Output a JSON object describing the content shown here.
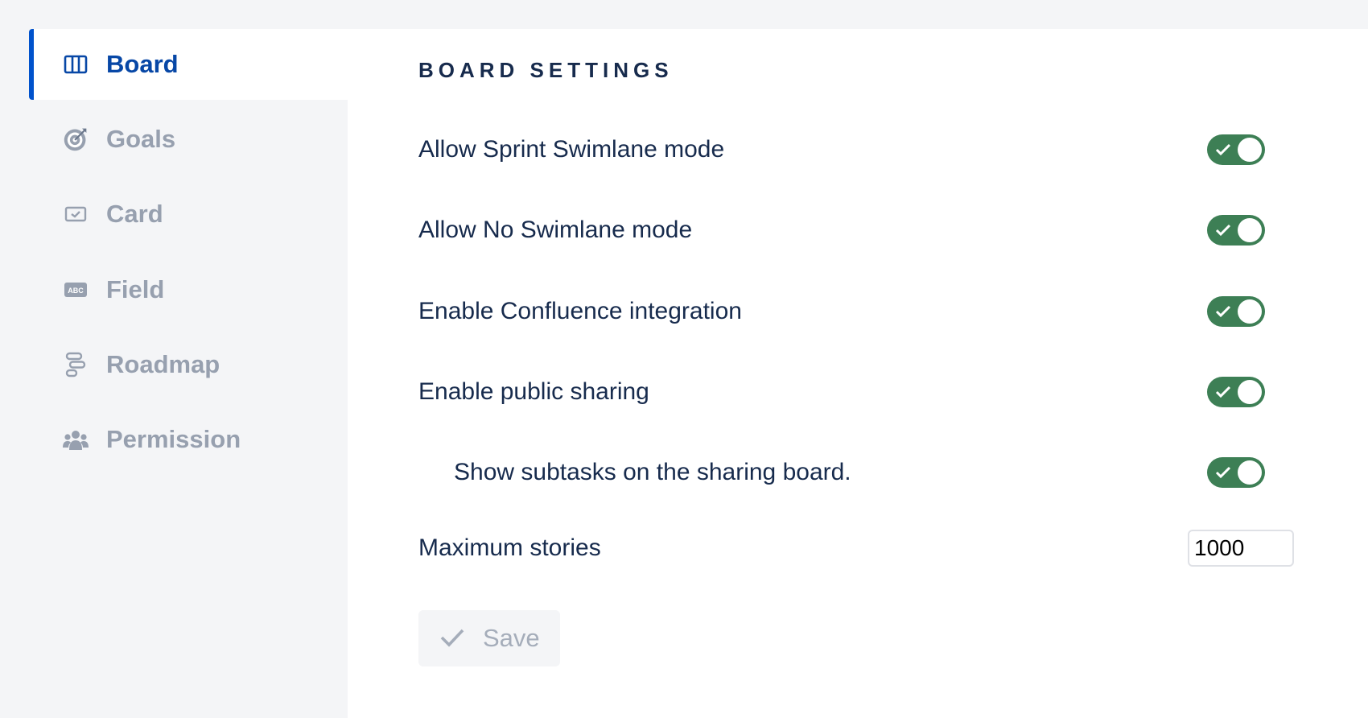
{
  "sidebar": {
    "items": [
      {
        "label": "Board",
        "icon": "board-columns-icon",
        "active": true
      },
      {
        "label": "Goals",
        "icon": "target-icon",
        "active": false
      },
      {
        "label": "Card",
        "icon": "card-icon",
        "active": false
      },
      {
        "label": "Field",
        "icon": "abc-field-icon",
        "active": false
      },
      {
        "label": "Roadmap",
        "icon": "roadmap-icon",
        "active": false
      },
      {
        "label": "Permission",
        "icon": "people-icon",
        "active": false
      }
    ]
  },
  "main": {
    "title": "BOARD SETTINGS",
    "settings": [
      {
        "label": "Allow Sprint Swimlane mode",
        "enabled": true
      },
      {
        "label": "Allow No Swimlane mode",
        "enabled": true
      },
      {
        "label": "Enable Confluence integration",
        "enabled": true
      },
      {
        "label": "Enable public sharing",
        "enabled": true
      },
      {
        "label": "Show subtasks on the sharing board.",
        "enabled": true
      }
    ],
    "max_stories": {
      "label": "Maximum stories",
      "value": "1000"
    },
    "save_label": "Save"
  },
  "colors": {
    "accent": "#0052cc",
    "toggle_on": "#3d7f55",
    "muted_text": "#97a0af",
    "text": "#172b4d"
  }
}
